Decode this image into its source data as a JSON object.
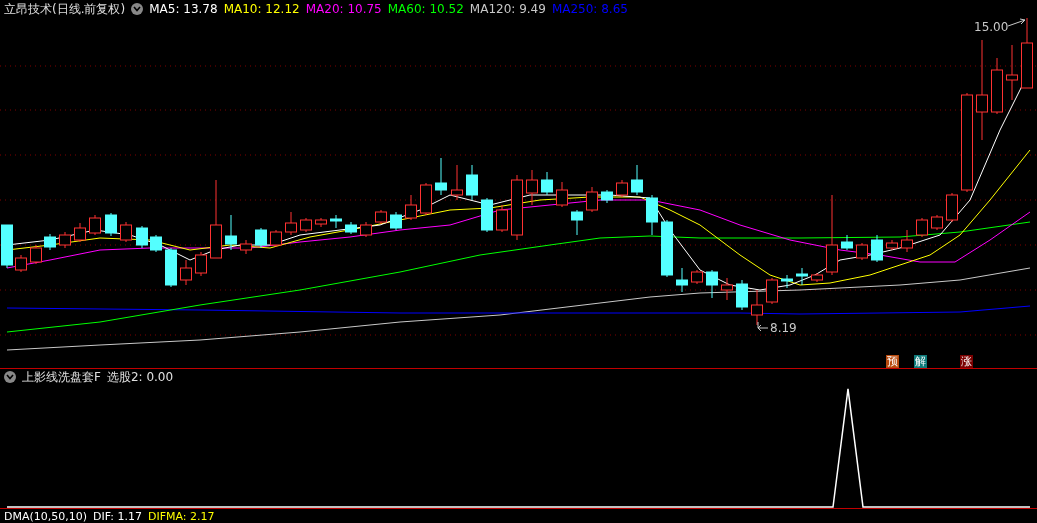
{
  "chart_title": "立昂技术(日线.前复权)",
  "moving_averages": [
    {
      "label": "MA5:",
      "value": "13.78",
      "color": "#ffffff"
    },
    {
      "label": "MA10:",
      "value": "12.12",
      "color": "#ffff00"
    },
    {
      "label": "MA20:",
      "value": "10.75",
      "color": "#ff00ff"
    },
    {
      "label": "MA60:",
      "value": "10.52",
      "color": "#00ff00"
    },
    {
      "label": "MA120:",
      "value": "9.49",
      "color": "#c8c8c8"
    },
    {
      "label": "MA250:",
      "value": "8.65",
      "color": "#0000ff"
    }
  ],
  "price_labels": {
    "high": "15.00",
    "low": "8.19"
  },
  "signals": [
    {
      "text": "预",
      "color": "#b84a0e"
    },
    {
      "text": "解",
      "color": "#0e7a7a"
    },
    {
      "text": "涨",
      "color": "#7a0000"
    }
  ],
  "indicator": {
    "title": "上影线洗盘套F",
    "reading": "选股2: 0.00"
  },
  "bottom_indicator": [
    {
      "text": "DMA(10,50,10)",
      "color": "#ffffff"
    },
    {
      "text": "DIF: 1.17",
      "color": "#ffffff"
    },
    {
      "text": "DIFMA: 2.17",
      "color": "#ffff00"
    }
  ]
}
